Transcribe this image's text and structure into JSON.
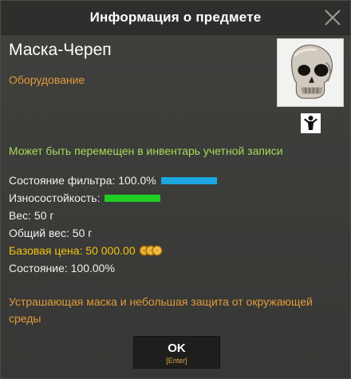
{
  "window": {
    "title": "Информация о предмете",
    "close_icon": "close-icon"
  },
  "item": {
    "name": "Маска-Череп",
    "category": "Оборудование",
    "image_icon": "skull-mask-image",
    "equip_icon": "person-equip-icon",
    "account_note": "Может быть перемещен в инвентарь учетной записи",
    "description": "Устрашающая маска и небольшая защита от окружающей среды"
  },
  "stats": {
    "filter_label": "Состояние фильтра: 100.0%",
    "filter_level": 1.0,
    "durability_label": "Износостойкость:",
    "durability_level": 1.0,
    "weight": "Вес: 50 г",
    "total_weight": "Общий вес: 50 г",
    "base_price": "Базовая цена: 50 000.00",
    "coins_icon": "coins-icon",
    "condition": "Состояние: 100.00%"
  },
  "ok_button": {
    "label": "OK",
    "hint": "[Enter]"
  },
  "colors": {
    "category": "#e19b3b",
    "account_note": "#a9d95a",
    "filter_bar": "#1da6df",
    "durability_bar": "#1fce22",
    "price": "#f1c40f"
  }
}
